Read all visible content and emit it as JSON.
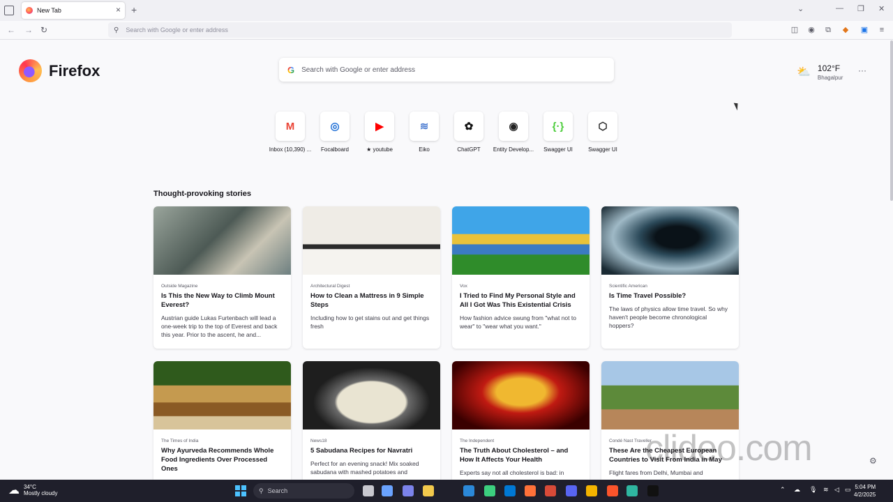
{
  "tab": {
    "title": "New Tab",
    "close": "×",
    "new": "+"
  },
  "window": {
    "list_tabs": "⌄",
    "minimize": "—",
    "restore": "❐",
    "close": "✕"
  },
  "nav": {
    "back": "←",
    "forward": "→",
    "reload": "↻",
    "url_placeholder": "Search with Google or enter address"
  },
  "toolbar_icons": [
    "pocket-icon",
    "account-icon",
    "extensions-icon",
    "metamask-icon",
    "translate-icon",
    "menu-icon"
  ],
  "brand": {
    "name": "Firefox"
  },
  "search": {
    "placeholder": "Search with Google or enter address",
    "engine_glyph": "G"
  },
  "weather": {
    "temp": "102°F",
    "city": "Bhagalpur"
  },
  "menu": {
    "dots": "···"
  },
  "shortcuts": [
    {
      "label": "Inbox (10,390) ...",
      "glyph": "M",
      "color": "#ea4335"
    },
    {
      "label": "Focalboard",
      "glyph": "◎",
      "color": "#1f6fd6"
    },
    {
      "label": "★ youtube",
      "glyph": "▶",
      "color": "#ff0000"
    },
    {
      "label": "Eiko",
      "glyph": "≋",
      "color": "#4a7bd0"
    },
    {
      "label": "ChatGPT",
      "glyph": "✿",
      "color": "#111111"
    },
    {
      "label": "Entity Develop...",
      "glyph": "◉",
      "color": "#222222"
    },
    {
      "label": "Swagger UI",
      "glyph": "{·}",
      "color": "#49cc38"
    },
    {
      "label": "Swagger UI",
      "glyph": "⬡",
      "color": "#222222"
    }
  ],
  "section": {
    "title": "Thought-provoking stories"
  },
  "stories": [
    {
      "publisher": "Outside Magazine",
      "title": "Is This the New Way to Climb Mount Everest?",
      "excerpt": "Austrian guide Lukas Furtenbach will lead a one-week trip to the top of Everest and back this year. Prior to the ascent, he and...",
      "thumb": "linear-gradient(135deg,#9aa59c,#4d5a55 45%,#c8c4b4 70%,#6d7f80)"
    },
    {
      "publisher": "Architectural Digest",
      "title": "How to Clean a Mattress in 9 Simple Steps",
      "excerpt": "Including how to get stains out and get things fresh",
      "thumb": "linear-gradient(180deg,#efece6 0 55%,#2b2b2b 56% 62%,#f5f3ef 63%)"
    },
    {
      "publisher": "Vox",
      "title": "I Tried to Find My Personal Style and All I Got Was This Existential Crisis",
      "excerpt": "How fashion advice swung from \"what not to wear\" to \"wear what you want.\"",
      "thumb": "linear-gradient(180deg,#3fa5e8 0 40%,#e9c23a 41% 55%,#3b7bc2 56% 70%,#2f8c2a 71%)"
    },
    {
      "publisher": "Scientific American",
      "title": "Is Time Travel Possible?",
      "excerpt": "The laws of physics allow time travel. So why haven't people become chronological hoppers?",
      "thumb": "radial-gradient(ellipse at 55% 45%,#0a1218 0 20%,#2c4a5a 35%,#9fb9c6 60%,#1a2a33 90%)"
    },
    {
      "publisher": "The Times of India",
      "title": "Why Ayurveda Recommends Whole Food Ingredients Over Processed Ones",
      "excerpt": "",
      "thumb": "linear-gradient(180deg,#2f5a1c 0 35%,#c59a4f 36% 60%,#8a5a24 61% 80%,#d8c49a 81%)"
    },
    {
      "publisher": "News18",
      "title": "5 Sabudana Recipes for Navratri",
      "excerpt": "Perfect for an evening snack! Mix soaked sabudana with mashed potatoes and",
      "thumb": "radial-gradient(ellipse at 50% 60%,#e9e4d2 0 35%,#6a6a6a 38%,#1e1e1e 60%)"
    },
    {
      "publisher": "The Independent",
      "title": "The Truth About Cholesterol – and How It Affects Your Health",
      "excerpt": "Experts say not all cholesterol is bad: in",
      "thumb": "radial-gradient(ellipse at 50% 45%,#f0b830 0 25%,#c01a12 40%,#3a0000 80%)"
    },
    {
      "publisher": "Condé Nast Traveller",
      "title": "These Are the Cheapest European Countries to Visit From India in May",
      "excerpt": "Flight fares from Delhi, Mumbai and",
      "thumb": "linear-gradient(180deg,#a7c7e6 0 35%,#5d8a3a 36% 70%,#b7865a 71%)"
    }
  ],
  "watermark": "clideo.com",
  "taskbar": {
    "weather_temp": "34°C",
    "weather_desc": "Mostly cloudy",
    "search_label": "Search",
    "time": "5:04 PM",
    "date": "4/2/2025",
    "apps": [
      "#c8c8cf",
      "#6aa3ff",
      "#7b83eb",
      "#f2c94c",
      "#2b88d8",
      "#3ccf7f",
      "#0078d4",
      "#ff7139",
      "#d84a38",
      "#5865f2",
      "#f4b400",
      "#fb542b",
      "#2fb6a0",
      "#111111"
    ]
  }
}
